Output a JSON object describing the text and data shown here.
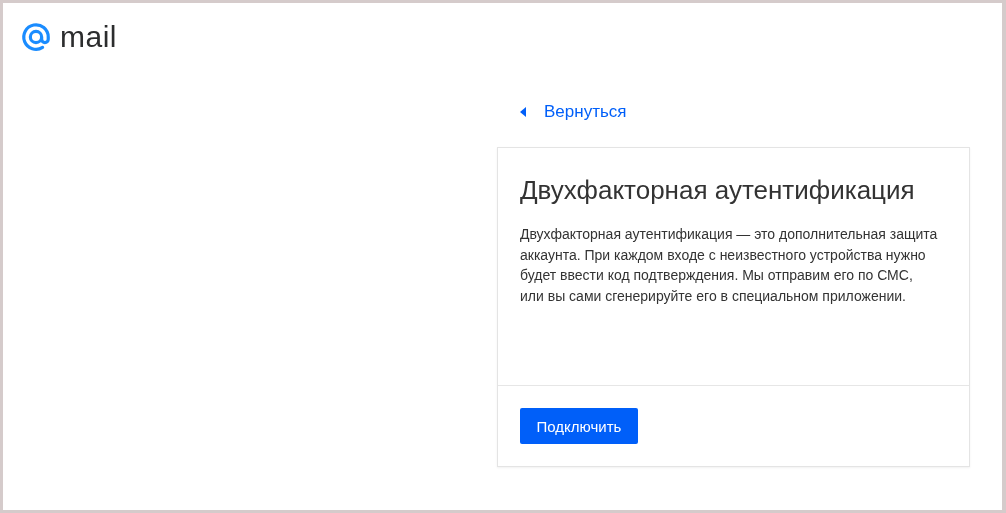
{
  "logo": {
    "text": "mail"
  },
  "back_link": {
    "label": "Вернуться"
  },
  "card": {
    "title": "Двухфакторная аутентификация",
    "description": "Двухфакторная аутентификация — это дополнительная защита аккаунта. При каждом входе с неизвестного устройства нужно будет ввести код подтверждения. Мы отправим его по СМС, или вы сами сгенерируйте его в специальном приложении.",
    "button": "Подключить"
  }
}
